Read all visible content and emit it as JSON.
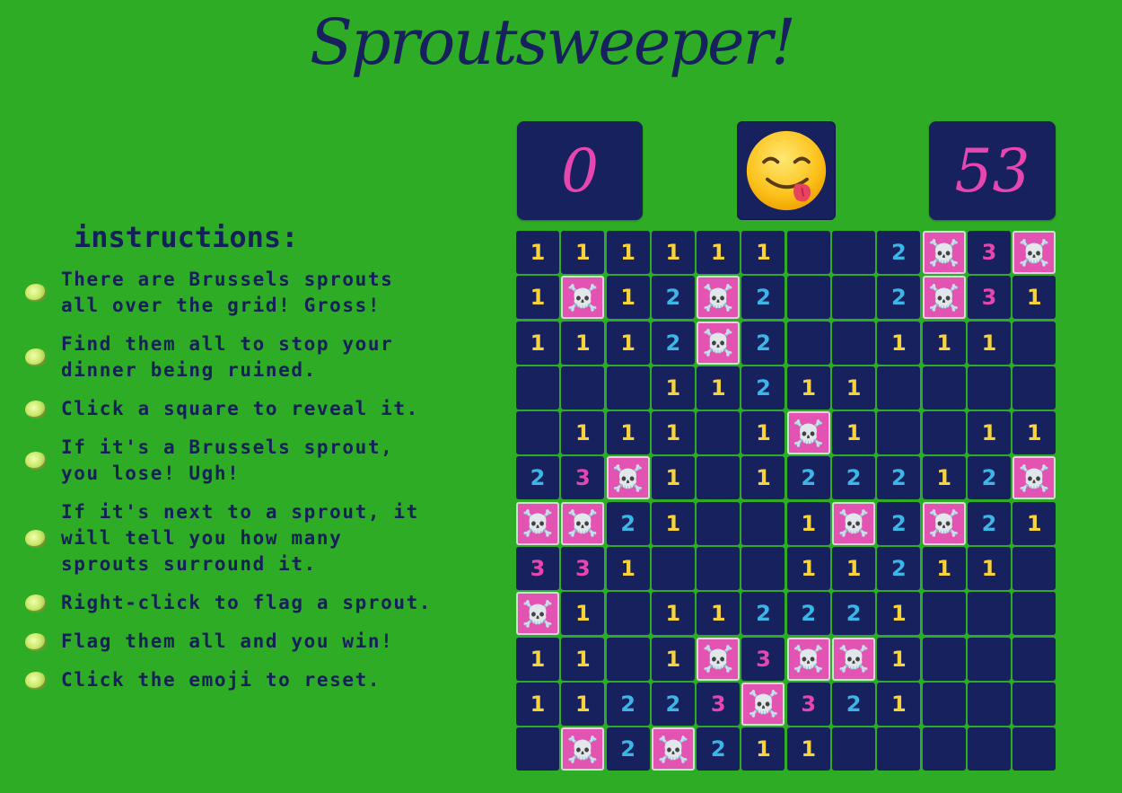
{
  "title": "Sproutsweeper!",
  "instructions": {
    "heading": "instructions:",
    "items": [
      "There are Brussels sprouts\nall over the grid! Gross!",
      "Find them all to stop your\ndinner being ruined.",
      "Click a square to reveal it.",
      "If it's a Brussels sprout,\nyou lose! Ugh!",
      "If it's next to a sprout, it\nwill tell you how many\nsprouts surround it.",
      "Right-click to flag a sprout.",
      "Flag them all and you win!",
      "Click the emoji to reset."
    ],
    "bullet_icon": "sprout-icon"
  },
  "counters": {
    "left": "0",
    "right": "53"
  },
  "reset_button": {
    "icon": "face-savoring-food-emoji"
  },
  "colors": {
    "background": "#2fac25",
    "cell": "#17215e",
    "mine_cell": "#e353b2",
    "num1": "#f8d43a",
    "num2": "#3bb6e6",
    "num3": "#e646b0"
  },
  "mine_symbol": "☠️",
  "board": [
    [
      "1",
      "1",
      "1",
      "1",
      "1",
      "1",
      "",
      "",
      "2",
      "M",
      "3",
      "M"
    ],
    [
      "1",
      "M",
      "1",
      "2",
      "M",
      "2",
      "",
      "",
      "2",
      "M",
      "3",
      "1"
    ],
    [
      "1",
      "1",
      "1",
      "2",
      "M",
      "2",
      "",
      "",
      "1",
      "1",
      "1",
      ""
    ],
    [
      "",
      "",
      "",
      "1",
      "1",
      "2",
      "1",
      "1",
      "",
      "",
      "",
      ""
    ],
    [
      "",
      "1",
      "1",
      "1",
      "",
      "1",
      "M",
      "1",
      "",
      "",
      "1",
      "1"
    ],
    [
      "2",
      "3",
      "M",
      "1",
      "",
      "1",
      "2",
      "2",
      "2",
      "1",
      "2",
      "M"
    ],
    [
      "M",
      "M",
      "2",
      "1",
      "",
      "",
      "1",
      "M",
      "2",
      "M",
      "2",
      "1"
    ],
    [
      "3",
      "3",
      "1",
      "",
      "",
      "",
      "1",
      "1",
      "2",
      "1",
      "1",
      ""
    ],
    [
      "M",
      "1",
      "",
      "1",
      "1",
      "2",
      "2",
      "2",
      "1",
      "",
      "",
      ""
    ],
    [
      "1",
      "1",
      "",
      "1",
      "M",
      "3",
      "M",
      "M",
      "1",
      "",
      "",
      ""
    ],
    [
      "1",
      "1",
      "2",
      "2",
      "3",
      "M",
      "3",
      "2",
      "1",
      "",
      "",
      ""
    ],
    [
      "",
      "M",
      "2",
      "M",
      "2",
      "1",
      "1",
      "",
      "",
      "",
      "",
      ""
    ]
  ]
}
